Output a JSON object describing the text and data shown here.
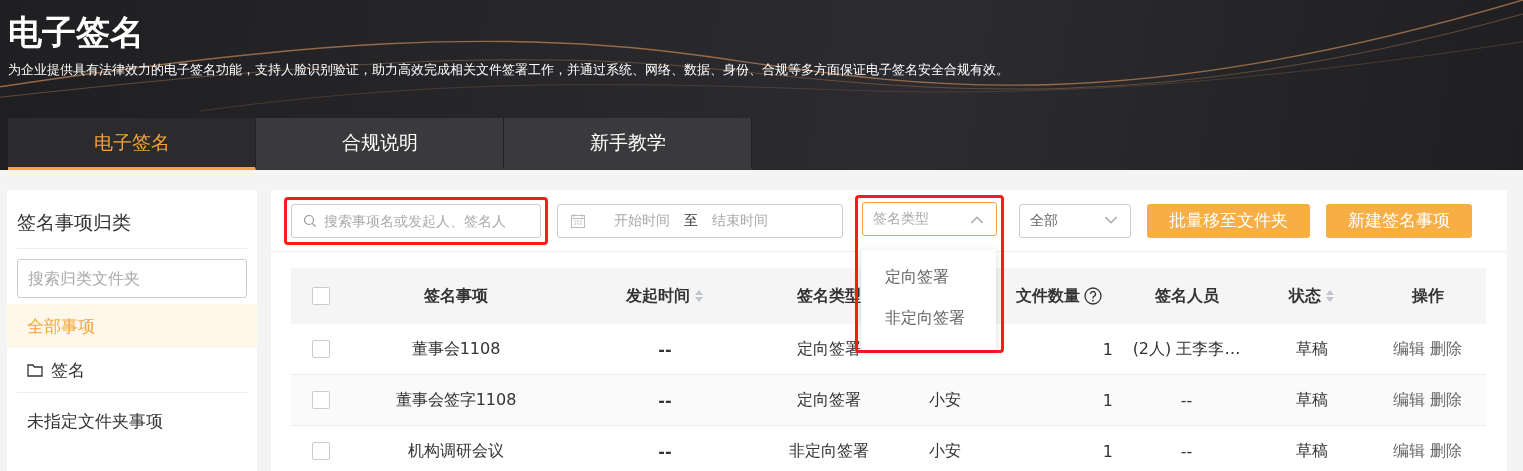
{
  "header": {
    "title": "电子签名",
    "description": "为企业提供具有法律效力的电子签名功能，支持人脸识别验证，助力高效完成相关文件签署工作，并通过系统、网络、数据、身份、合规等多方面保证电子签名安全合规有效。"
  },
  "tabs": [
    {
      "label": "电子签名",
      "selected": true
    },
    {
      "label": "合规说明",
      "selected": false
    },
    {
      "label": "新手教学",
      "selected": false
    }
  ],
  "sidebar": {
    "title": "签名事项归类",
    "search": {
      "placeholder": "搜索归类文件夹"
    },
    "items": [
      {
        "label": "全部事项",
        "kind": "plain",
        "selected": true
      },
      {
        "label": "签名",
        "kind": "folder",
        "selected": false
      },
      {
        "label": "未指定文件夹事项",
        "kind": "plain",
        "selected": false
      }
    ]
  },
  "toolbar": {
    "search": {
      "placeholder": "搜索事项名或发起人、签名人",
      "highlighted": true
    },
    "date_range": {
      "start_placeholder": "开始时间",
      "separator": "至",
      "end_placeholder": "结束时间"
    },
    "type_select": {
      "placeholder": "签名类型",
      "expanded": true,
      "highlighted": true,
      "options": [
        "定向签署",
        "非定向签署"
      ]
    },
    "status_select": {
      "value": "全部",
      "expanded": false
    },
    "buttons": [
      "批量移至文件夹",
      "新建签名事项"
    ]
  },
  "table": {
    "columns": [
      {
        "kind": "check",
        "checked": false
      },
      {
        "label": "签名事项"
      },
      {
        "label": "发起时间",
        "sortable": true
      },
      {
        "label": "签名类型"
      },
      {
        "kind": "hidden"
      },
      {
        "label": "文件数量",
        "help": true
      },
      {
        "label": "签名人员"
      },
      {
        "label": "状态",
        "sortable": true
      },
      {
        "label": "操作"
      }
    ],
    "rows": [
      {
        "checked": false,
        "name": "董事会1108",
        "time": "--",
        "type": "定向签署",
        "count": "1",
        "signers": "(2人) 王李李…",
        "status": "草稿",
        "actions": [
          "编辑",
          "删除"
        ]
      },
      {
        "checked": false,
        "name": "董事会签字1108",
        "time": "--",
        "type": "定向签署",
        "initiator": "小安",
        "count": "1",
        "signers": "--",
        "status": "草稿",
        "actions": [
          "编辑",
          "删除"
        ]
      },
      {
        "checked": false,
        "name": "机构调研会议",
        "time": "--",
        "type": "非定向签署",
        "initiator": "小安",
        "count": "1",
        "signers": "--",
        "status": "草稿",
        "actions": [
          "编辑",
          "删除"
        ]
      }
    ]
  }
}
